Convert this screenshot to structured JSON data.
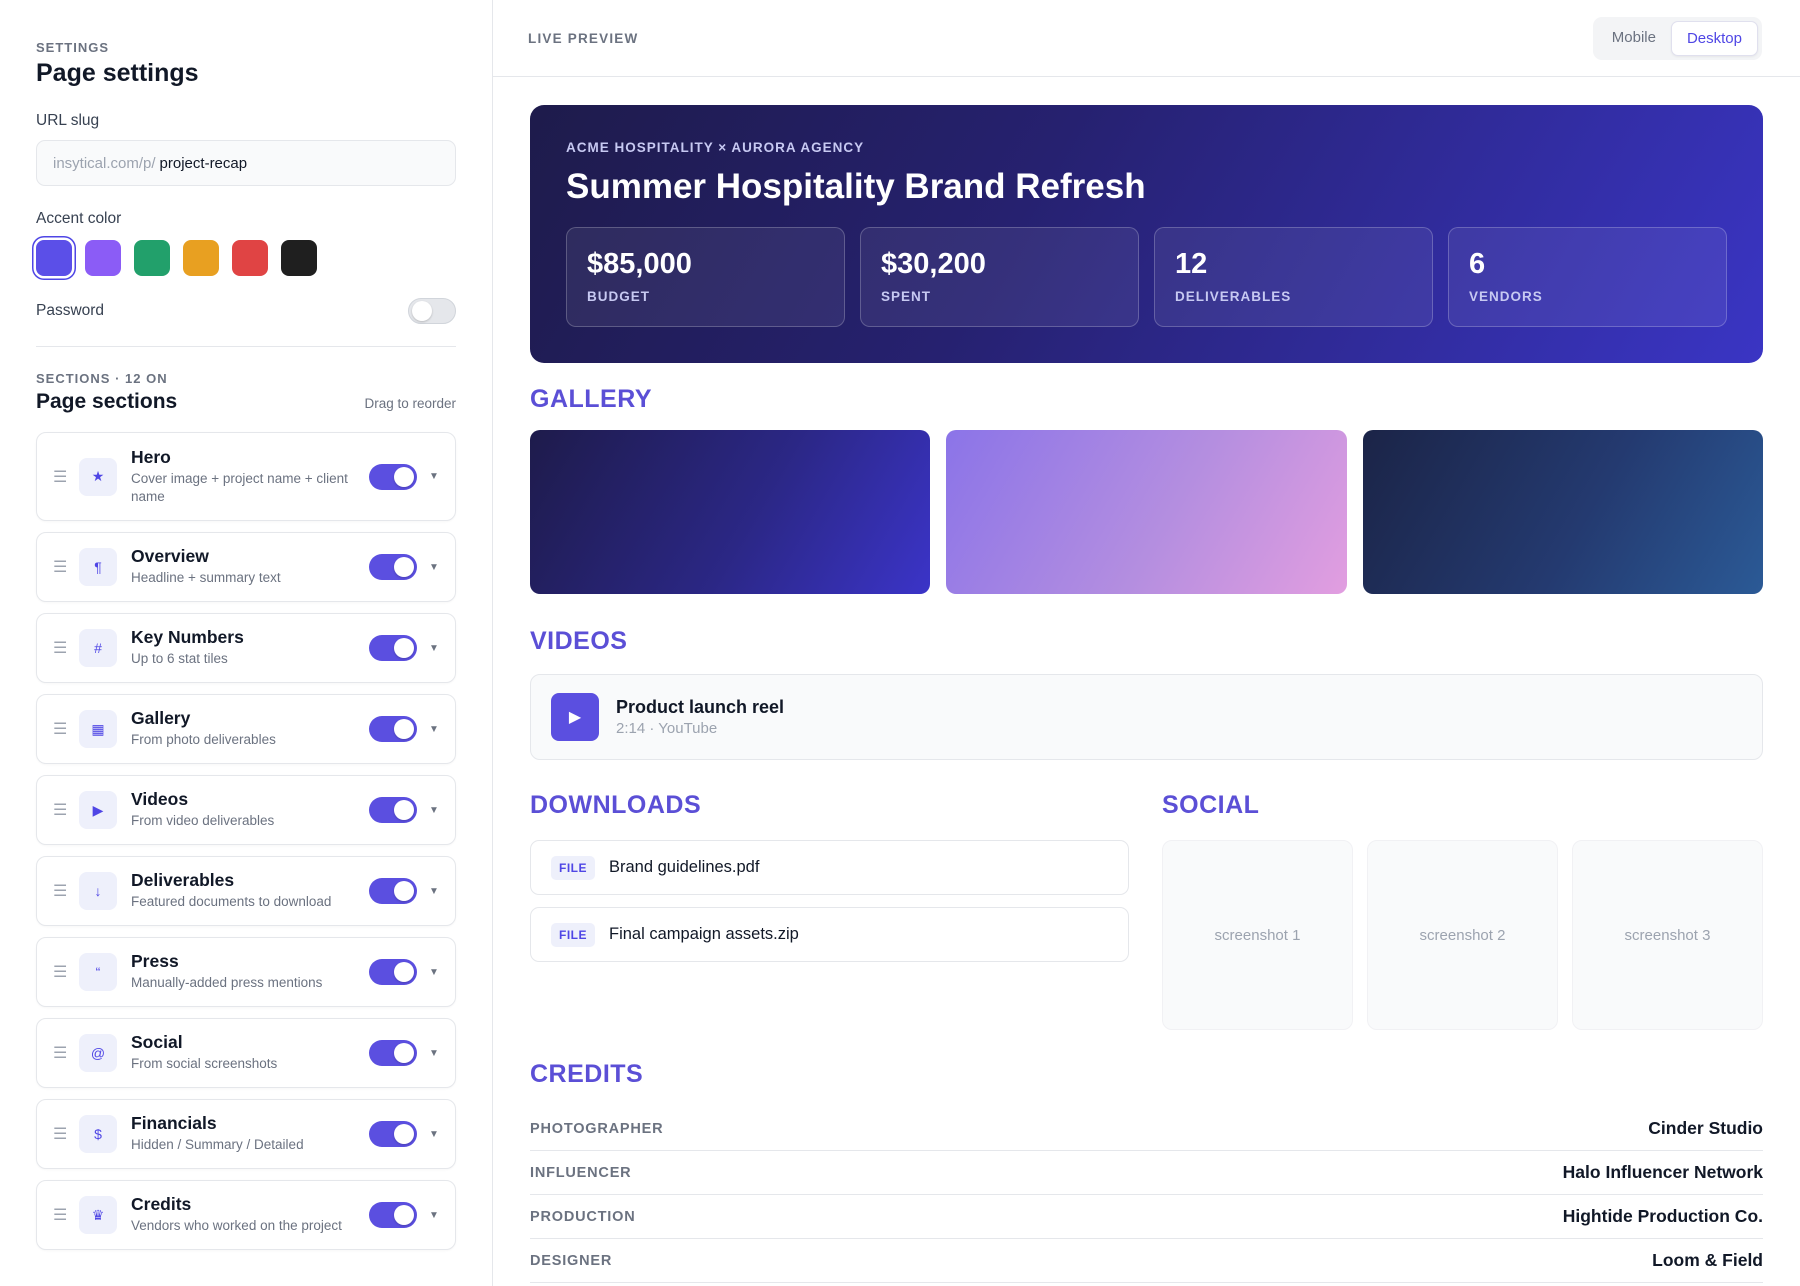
{
  "sidebar": {
    "eyebrow": "SETTINGS",
    "title": "Page settings",
    "url_slug": {
      "label": "URL slug",
      "prefix": "insytical.com/p/",
      "value": "project-recap"
    },
    "accent": {
      "label": "Accent color",
      "selected": 0,
      "colors": [
        "#5b4fe8",
        "#8b5cf6",
        "#22a06b",
        "#e8a021",
        "#e04444",
        "#1f1f1f"
      ]
    },
    "password": {
      "label": "Password",
      "enabled": false
    },
    "sections_eyebrow": "SECTIONS · 12 ON",
    "sections_title": "Page sections",
    "drag_hint": "Drag to reorder",
    "sections": [
      {
        "name": "Hero",
        "desc": "Cover image + project name + client name",
        "icon": "★",
        "icon_name": "star-icon",
        "enabled": true
      },
      {
        "name": "Overview",
        "desc": "Headline + summary text",
        "icon": "¶",
        "icon_name": "paragraph-icon",
        "enabled": true
      },
      {
        "name": "Key Numbers",
        "desc": "Up to 6 stat tiles",
        "icon": "#",
        "icon_name": "hash-icon",
        "enabled": true
      },
      {
        "name": "Gallery",
        "desc": "From photo deliverables",
        "icon": "▦",
        "icon_name": "grid-icon",
        "enabled": true
      },
      {
        "name": "Videos",
        "desc": "From video deliverables",
        "icon": "▶",
        "icon_name": "play-icon",
        "enabled": true
      },
      {
        "name": "Deliverables",
        "desc": "Featured documents to download",
        "icon": "↓",
        "icon_name": "download-icon",
        "enabled": true
      },
      {
        "name": "Press",
        "desc": "Manually-added press mentions",
        "icon": "“",
        "icon_name": "quote-icon",
        "enabled": true
      },
      {
        "name": "Social",
        "desc": "From social screenshots",
        "icon": "@",
        "icon_name": "at-icon",
        "enabled": true
      },
      {
        "name": "Financials",
        "desc": "Hidden / Summary / Detailed",
        "icon": "$",
        "icon_name": "dollar-icon",
        "enabled": true
      },
      {
        "name": "Credits",
        "desc": "Vendors who worked on the project",
        "icon": "♛",
        "icon_name": "crown-icon",
        "enabled": true
      }
    ]
  },
  "preview": {
    "label": "LIVE PREVIEW",
    "device_options": [
      "Mobile",
      "Desktop"
    ],
    "device_selected": "Desktop",
    "hero": {
      "eyebrow": "ACME HOSPITALITY × AURORA AGENCY",
      "title": "Summer Hospitality Brand Refresh",
      "stats": [
        {
          "value": "$85,000",
          "label": "BUDGET"
        },
        {
          "value": "$30,200",
          "label": "SPENT"
        },
        {
          "value": "12",
          "label": "DELIVERABLES"
        },
        {
          "value": "6",
          "label": "VENDORS"
        }
      ]
    },
    "gallery": {
      "title": "GALLERY",
      "tiles": [
        "linear-gradient(120deg, #1e1b4b 0%, #2b2785 55%, #3b34c8 100%)",
        "linear-gradient(120deg, #8b74e8 0%, #b48ee0 55%, #e29ee0 100%)",
        "linear-gradient(120deg, #1b2447 0%, #243a70 55%, #2b5a96 100%)"
      ]
    },
    "videos": {
      "title": "VIDEOS",
      "items": [
        {
          "title": "Product launch reel",
          "meta": "2:14 · YouTube"
        }
      ]
    },
    "downloads": {
      "title": "DOWNLOADS",
      "files": [
        {
          "badge": "FILE",
          "name": "Brand guidelines.pdf"
        },
        {
          "badge": "FILE",
          "name": "Final campaign assets.zip"
        }
      ]
    },
    "social": {
      "title": "SOCIAL",
      "shots": [
        "screenshot 1",
        "screenshot 2",
        "screenshot 3"
      ]
    },
    "credits": {
      "title": "CREDITS",
      "rows": [
        {
          "role": "PHOTOGRAPHER",
          "name": "Cinder Studio"
        },
        {
          "role": "INFLUENCER",
          "name": "Halo Influencer Network"
        },
        {
          "role": "PRODUCTION",
          "name": "Hightide Production Co."
        },
        {
          "role": "DESIGNER",
          "name": "Loom & Field"
        }
      ]
    }
  }
}
